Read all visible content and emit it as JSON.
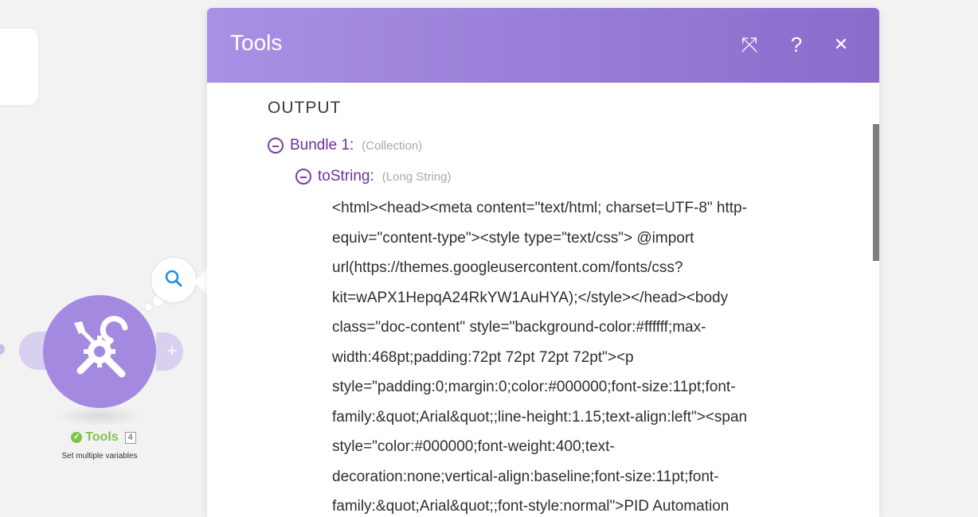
{
  "scenario": {
    "module": {
      "name": "Tools",
      "count": "4",
      "description": "Set multiple variables",
      "icon": "tools-icon",
      "status_icon": "check-circle-icon",
      "color": "#a489e1",
      "status_color": "#7cc34a"
    },
    "add_handle_icon": "+",
    "search_icon": "search-icon"
  },
  "panel": {
    "title": "Tools",
    "header_gradient": [
      "#a891e4",
      "#8a6ccb"
    ],
    "buttons": {
      "expand_icon": "⤧",
      "help_label": "?",
      "close_label": "✕"
    },
    "output_label": "OUTPUT",
    "bundle": {
      "key": "Bundle 1:",
      "type": "(Collection)",
      "children": [
        {
          "key": "toString:",
          "type": "(Long String)",
          "lines": [
            "<html><head><meta content=\"text/html; charset=UTF-8\" http-",
            "equiv=\"content-type\"><style type=\"text/css\"> @import",
            "url(https://themes.googleusercontent.com/fonts/css?",
            "kit=wAPX1HepqA24RkYW1AuHYA);</style></head><body",
            "class=\"doc-content\" style=\"background-color:#ffffff;max-",
            "width:468pt;padding:72pt 72pt 72pt 72pt\"><p",
            "style=\"padding:0;margin:0;color:#000000;font-size:11pt;font-",
            "family:&quot;Arial&quot;;line-height:1.15;text-align:left\"><span",
            "style=\"color:#000000;font-weight:400;text-",
            "decoration:none;vertical-align:baseline;font-size:11pt;font-",
            "family:&quot;Arial&quot;;font-style:normal\">PID Automation"
          ]
        }
      ]
    }
  }
}
